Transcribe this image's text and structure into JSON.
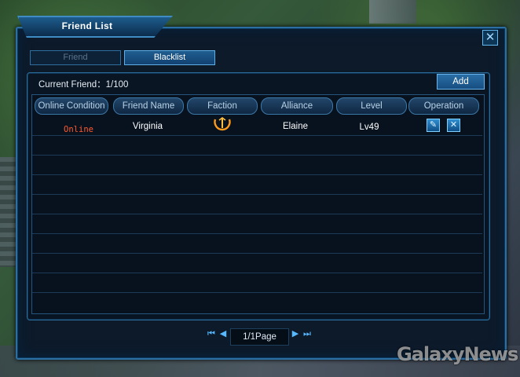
{
  "window": {
    "title": "Friend List"
  },
  "tabs": [
    {
      "label": "Friend",
      "active": false
    },
    {
      "label": "Blacklist",
      "active": true
    }
  ],
  "summary": {
    "current_friend": "Current Friend：1/100"
  },
  "buttons": {
    "add": "Add"
  },
  "columns": [
    "Online Condition",
    "Friend Name",
    "Faction",
    "Alliance",
    "Level",
    "Operation"
  ],
  "rows": [
    {
      "status": "Online",
      "name": "Virginia",
      "faction_icon": "faction-emblem-icon",
      "alliance": "Elaine",
      "level": "Lv49",
      "operations": [
        "edit-icon",
        "delete-icon"
      ]
    }
  ],
  "pagination": {
    "label": "1/1Page"
  },
  "colors": {
    "online": "#ff5a2e",
    "accent": "#3f8cc4"
  },
  "watermark": "GalaxyNews"
}
